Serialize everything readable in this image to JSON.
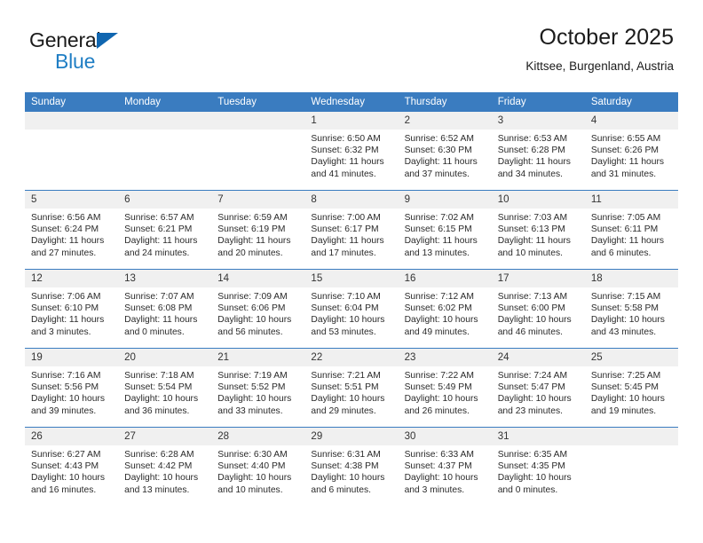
{
  "brand": {
    "line1": "General",
    "line2": "Blue",
    "triangle_color": "#1066b0",
    "blue_text_color": "#1f7ec4"
  },
  "header": {
    "title": "October 2025",
    "subtitle": "Kittsee, Burgenland, Austria"
  },
  "calendar": {
    "header_bg": "#3a7cc0",
    "daynum_bg": "#f0f0f0",
    "weekday_headers": [
      "Sunday",
      "Monday",
      "Tuesday",
      "Wednesday",
      "Thursday",
      "Friday",
      "Saturday"
    ],
    "weeks": [
      [
        {
          "day": "",
          "sunrise": "",
          "sunset": "",
          "daylight_line1": "",
          "daylight_line2": ""
        },
        {
          "day": "",
          "sunrise": "",
          "sunset": "",
          "daylight_line1": "",
          "daylight_line2": ""
        },
        {
          "day": "",
          "sunrise": "",
          "sunset": "",
          "daylight_line1": "",
          "daylight_line2": ""
        },
        {
          "day": "1",
          "sunrise": "Sunrise: 6:50 AM",
          "sunset": "Sunset: 6:32 PM",
          "daylight_line1": "Daylight: 11 hours",
          "daylight_line2": "and 41 minutes."
        },
        {
          "day": "2",
          "sunrise": "Sunrise: 6:52 AM",
          "sunset": "Sunset: 6:30 PM",
          "daylight_line1": "Daylight: 11 hours",
          "daylight_line2": "and 37 minutes."
        },
        {
          "day": "3",
          "sunrise": "Sunrise: 6:53 AM",
          "sunset": "Sunset: 6:28 PM",
          "daylight_line1": "Daylight: 11 hours",
          "daylight_line2": "and 34 minutes."
        },
        {
          "day": "4",
          "sunrise": "Sunrise: 6:55 AM",
          "sunset": "Sunset: 6:26 PM",
          "daylight_line1": "Daylight: 11 hours",
          "daylight_line2": "and 31 minutes."
        }
      ],
      [
        {
          "day": "5",
          "sunrise": "Sunrise: 6:56 AM",
          "sunset": "Sunset: 6:24 PM",
          "daylight_line1": "Daylight: 11 hours",
          "daylight_line2": "and 27 minutes."
        },
        {
          "day": "6",
          "sunrise": "Sunrise: 6:57 AM",
          "sunset": "Sunset: 6:21 PM",
          "daylight_line1": "Daylight: 11 hours",
          "daylight_line2": "and 24 minutes."
        },
        {
          "day": "7",
          "sunrise": "Sunrise: 6:59 AM",
          "sunset": "Sunset: 6:19 PM",
          "daylight_line1": "Daylight: 11 hours",
          "daylight_line2": "and 20 minutes."
        },
        {
          "day": "8",
          "sunrise": "Sunrise: 7:00 AM",
          "sunset": "Sunset: 6:17 PM",
          "daylight_line1": "Daylight: 11 hours",
          "daylight_line2": "and 17 minutes."
        },
        {
          "day": "9",
          "sunrise": "Sunrise: 7:02 AM",
          "sunset": "Sunset: 6:15 PM",
          "daylight_line1": "Daylight: 11 hours",
          "daylight_line2": "and 13 minutes."
        },
        {
          "day": "10",
          "sunrise": "Sunrise: 7:03 AM",
          "sunset": "Sunset: 6:13 PM",
          "daylight_line1": "Daylight: 11 hours",
          "daylight_line2": "and 10 minutes."
        },
        {
          "day": "11",
          "sunrise": "Sunrise: 7:05 AM",
          "sunset": "Sunset: 6:11 PM",
          "daylight_line1": "Daylight: 11 hours",
          "daylight_line2": "and 6 minutes."
        }
      ],
      [
        {
          "day": "12",
          "sunrise": "Sunrise: 7:06 AM",
          "sunset": "Sunset: 6:10 PM",
          "daylight_line1": "Daylight: 11 hours",
          "daylight_line2": "and 3 minutes."
        },
        {
          "day": "13",
          "sunrise": "Sunrise: 7:07 AM",
          "sunset": "Sunset: 6:08 PM",
          "daylight_line1": "Daylight: 11 hours",
          "daylight_line2": "and 0 minutes."
        },
        {
          "day": "14",
          "sunrise": "Sunrise: 7:09 AM",
          "sunset": "Sunset: 6:06 PM",
          "daylight_line1": "Daylight: 10 hours",
          "daylight_line2": "and 56 minutes."
        },
        {
          "day": "15",
          "sunrise": "Sunrise: 7:10 AM",
          "sunset": "Sunset: 6:04 PM",
          "daylight_line1": "Daylight: 10 hours",
          "daylight_line2": "and 53 minutes."
        },
        {
          "day": "16",
          "sunrise": "Sunrise: 7:12 AM",
          "sunset": "Sunset: 6:02 PM",
          "daylight_line1": "Daylight: 10 hours",
          "daylight_line2": "and 49 minutes."
        },
        {
          "day": "17",
          "sunrise": "Sunrise: 7:13 AM",
          "sunset": "Sunset: 6:00 PM",
          "daylight_line1": "Daylight: 10 hours",
          "daylight_line2": "and 46 minutes."
        },
        {
          "day": "18",
          "sunrise": "Sunrise: 7:15 AM",
          "sunset": "Sunset: 5:58 PM",
          "daylight_line1": "Daylight: 10 hours",
          "daylight_line2": "and 43 minutes."
        }
      ],
      [
        {
          "day": "19",
          "sunrise": "Sunrise: 7:16 AM",
          "sunset": "Sunset: 5:56 PM",
          "daylight_line1": "Daylight: 10 hours",
          "daylight_line2": "and 39 minutes."
        },
        {
          "day": "20",
          "sunrise": "Sunrise: 7:18 AM",
          "sunset": "Sunset: 5:54 PM",
          "daylight_line1": "Daylight: 10 hours",
          "daylight_line2": "and 36 minutes."
        },
        {
          "day": "21",
          "sunrise": "Sunrise: 7:19 AM",
          "sunset": "Sunset: 5:52 PM",
          "daylight_line1": "Daylight: 10 hours",
          "daylight_line2": "and 33 minutes."
        },
        {
          "day": "22",
          "sunrise": "Sunrise: 7:21 AM",
          "sunset": "Sunset: 5:51 PM",
          "daylight_line1": "Daylight: 10 hours",
          "daylight_line2": "and 29 minutes."
        },
        {
          "day": "23",
          "sunrise": "Sunrise: 7:22 AM",
          "sunset": "Sunset: 5:49 PM",
          "daylight_line1": "Daylight: 10 hours",
          "daylight_line2": "and 26 minutes."
        },
        {
          "day": "24",
          "sunrise": "Sunrise: 7:24 AM",
          "sunset": "Sunset: 5:47 PM",
          "daylight_line1": "Daylight: 10 hours",
          "daylight_line2": "and 23 minutes."
        },
        {
          "day": "25",
          "sunrise": "Sunrise: 7:25 AM",
          "sunset": "Sunset: 5:45 PM",
          "daylight_line1": "Daylight: 10 hours",
          "daylight_line2": "and 19 minutes."
        }
      ],
      [
        {
          "day": "26",
          "sunrise": "Sunrise: 6:27 AM",
          "sunset": "Sunset: 4:43 PM",
          "daylight_line1": "Daylight: 10 hours",
          "daylight_line2": "and 16 minutes."
        },
        {
          "day": "27",
          "sunrise": "Sunrise: 6:28 AM",
          "sunset": "Sunset: 4:42 PM",
          "daylight_line1": "Daylight: 10 hours",
          "daylight_line2": "and 13 minutes."
        },
        {
          "day": "28",
          "sunrise": "Sunrise: 6:30 AM",
          "sunset": "Sunset: 4:40 PM",
          "daylight_line1": "Daylight: 10 hours",
          "daylight_line2": "and 10 minutes."
        },
        {
          "day": "29",
          "sunrise": "Sunrise: 6:31 AM",
          "sunset": "Sunset: 4:38 PM",
          "daylight_line1": "Daylight: 10 hours",
          "daylight_line2": "and 6 minutes."
        },
        {
          "day": "30",
          "sunrise": "Sunrise: 6:33 AM",
          "sunset": "Sunset: 4:37 PM",
          "daylight_line1": "Daylight: 10 hours",
          "daylight_line2": "and 3 minutes."
        },
        {
          "day": "31",
          "sunrise": "Sunrise: 6:35 AM",
          "sunset": "Sunset: 4:35 PM",
          "daylight_line1": "Daylight: 10 hours",
          "daylight_line2": "and 0 minutes."
        },
        {
          "day": "",
          "sunrise": "",
          "sunset": "",
          "daylight_line1": "",
          "daylight_line2": ""
        }
      ]
    ]
  }
}
